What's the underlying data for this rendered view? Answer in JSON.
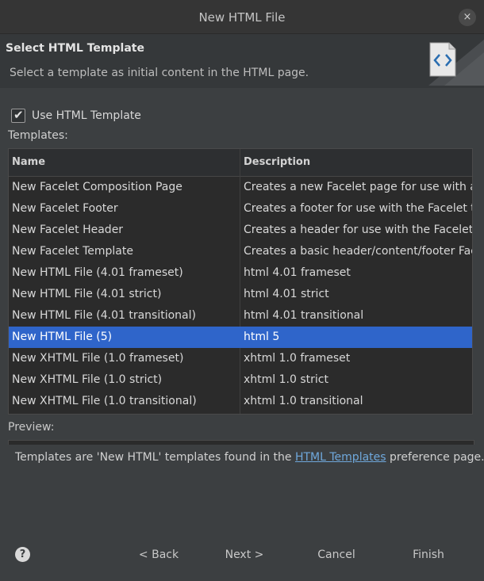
{
  "window": {
    "title": "New HTML File",
    "close_glyph": "×"
  },
  "header": {
    "title": "Select HTML Template",
    "description": "Select a template as initial content in the HTML page.",
    "icon": "html-document-icon"
  },
  "use_template": {
    "label": "Use HTML Template",
    "checked": true
  },
  "templates": {
    "label": "Templates:",
    "columns": {
      "name": "Name",
      "description": "Description"
    },
    "rows": [
      {
        "name": "New Facelet Composition Page",
        "description": "Creates a new Facelet page for use with a"
      },
      {
        "name": "New Facelet Footer",
        "description": "Creates a footer for use with the Facelet te"
      },
      {
        "name": "New Facelet Header",
        "description": "Creates a header for use with the Facelet t"
      },
      {
        "name": "New Facelet Template",
        "description": "Creates a basic header/content/footer Face"
      },
      {
        "name": "New HTML File (4.01 frameset)",
        "description": "html 4.01 frameset"
      },
      {
        "name": "New HTML File (4.01 strict)",
        "description": "html 4.01 strict"
      },
      {
        "name": "New HTML File (4.01 transitional)",
        "description": "html 4.01 transitional"
      },
      {
        "name": "New HTML File (5)",
        "description": "html 5"
      },
      {
        "name": "New XHTML File (1.0 frameset)",
        "description": "xhtml 1.0 frameset"
      },
      {
        "name": "New XHTML File (1.0 strict)",
        "description": "xhtml 1.0 strict"
      },
      {
        "name": "New XHTML File (1.0 transitional)",
        "description": "xhtml 1.0 transitional"
      }
    ],
    "selected_index": 7
  },
  "preview": {
    "label": "Preview:"
  },
  "info": {
    "before": "Templates are 'New HTML' templates found in the ",
    "link": "HTML Templates",
    "after": " preference page."
  },
  "buttons": {
    "help": "?",
    "back": "< Back",
    "next": "Next >",
    "cancel": "Cancel",
    "finish": "Finish"
  },
  "colors": {
    "background": "#3c3f41",
    "selection": "#2f65ca",
    "link": "#6fa8dc"
  }
}
